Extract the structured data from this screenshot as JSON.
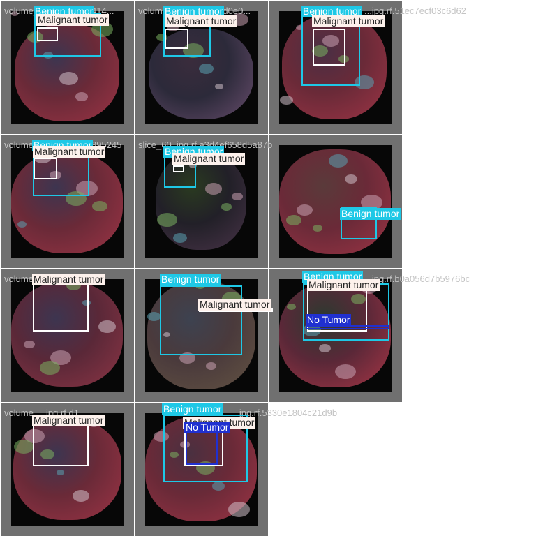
{
  "colors": {
    "benign": "#1ec8e6",
    "malignant": "#ffffff",
    "malignant_label_bg": "#fdf1ec",
    "notumor": "#2030d0",
    "cell_bg": "#707070",
    "scan_bg": "#070707"
  },
  "classes": {
    "benign": "Benign tumor",
    "malignant": "Malignant tumor",
    "notumor": "No Tumor"
  },
  "tiles": [
    {
      "filename": "volume_...jpg.rf.d4f14414...",
      "filename_right": "...jpg.rf.51ec7ecf03c6d62",
      "detections": [
        {
          "cls": "benign"
        },
        {
          "cls": "malignant"
        }
      ]
    },
    {
      "filename": "volume_...jpg.rf.96e8d0e0...",
      "detections": [
        {
          "cls": "benign"
        },
        {
          "cls": "malignant"
        }
      ]
    },
    {
      "filename": "",
      "detections": [
        {
          "cls": "benign"
        },
        {
          "cls": "malignant"
        }
      ]
    },
    {
      "filename": "volume_...jpg.rf.4f5a3895245",
      "filename_right": "slice_60_jpg.rf.a3d4ef658d5a87b",
      "detections": [
        {
          "cls": "benign"
        },
        {
          "cls": "malignant"
        }
      ]
    },
    {
      "filename": "",
      "detections": [
        {
          "cls": "benign"
        },
        {
          "cls": "malignant"
        }
      ]
    },
    {
      "filename": "",
      "detections": [
        {
          "cls": "benign"
        }
      ]
    },
    {
      "filename": "volume_...jpg.rf.c6...",
      "filename_right": "...jpg.rf.b0a056d7b5976bc",
      "detections": [
        {
          "cls": "malignant"
        }
      ]
    },
    {
      "filename": "",
      "detections": [
        {
          "cls": "benign"
        },
        {
          "cls": "malignant"
        }
      ]
    },
    {
      "filename": "",
      "detections": [
        {
          "cls": "benign"
        },
        {
          "cls": "malignant"
        },
        {
          "cls": "notumor"
        }
      ]
    },
    {
      "filename": "volume_...jpg.rf.d1...",
      "filename_right": "...jpg.rf.5330e1804c21d9b",
      "detections": [
        {
          "cls": "malignant"
        }
      ]
    },
    {
      "filename": "",
      "detections": [
        {
          "cls": "benign"
        },
        {
          "cls": "malignant"
        },
        {
          "cls": "notumor"
        }
      ]
    }
  ]
}
